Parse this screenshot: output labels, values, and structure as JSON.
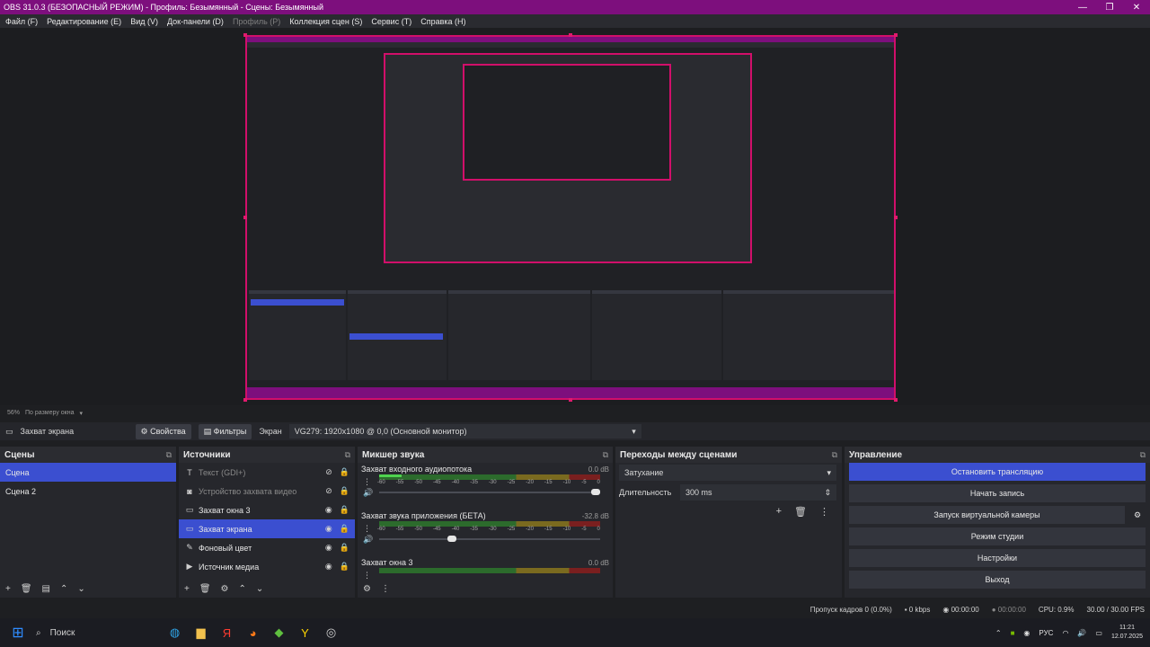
{
  "window": {
    "title": "OBS 31.0.3 (БЕЗОПАСНЫЙ РЕЖИМ) - Профиль: Безымянный - Сцены: Безымянный",
    "controls": [
      "—",
      "❐",
      "✕"
    ]
  },
  "menu": [
    {
      "label": "Файл (F)",
      "dim": false
    },
    {
      "label": "Редактирование (E)",
      "dim": false
    },
    {
      "label": "Вид (V)",
      "dim": false
    },
    {
      "label": "Док-панели (D)",
      "dim": false
    },
    {
      "label": "Профиль (P)",
      "dim": true
    },
    {
      "label": "Коллекция сцен (S)",
      "dim": false
    },
    {
      "label": "Сервис (T)",
      "dim": false
    },
    {
      "label": "Справка (H)",
      "dim": false
    }
  ],
  "preview": {
    "zoom": "56%",
    "scale_mode": "По размеру окна"
  },
  "source_toolbar": {
    "source_name": "Захват экрана",
    "properties": "Свойства",
    "filters": "Фильтры",
    "screen_label": "Экран",
    "screen_value": "VG279: 1920x1080 @ 0,0 (Основной монитор)"
  },
  "scenes": {
    "title": "Сцены",
    "items": [
      {
        "label": "Сцена",
        "selected": true
      },
      {
        "label": "Сцена 2",
        "selected": false
      }
    ]
  },
  "sources": {
    "title": "Источники",
    "items": [
      {
        "label": "Текст (GDI+)",
        "icon": "text-icon",
        "glyph": "T",
        "hidden": true,
        "selected": false
      },
      {
        "label": "Устройство захвата видео",
        "icon": "camera-icon",
        "glyph": "◙",
        "hidden": true,
        "selected": false
      },
      {
        "label": "Захват окна 3",
        "icon": "window-icon",
        "glyph": "▭",
        "hidden": false,
        "selected": false
      },
      {
        "label": "Захват экрана",
        "icon": "monitor-icon",
        "glyph": "▭",
        "hidden": false,
        "selected": true
      },
      {
        "label": "Фоновый цвет",
        "icon": "brush-icon",
        "glyph": "✎",
        "hidden": false,
        "selected": false
      },
      {
        "label": "Источник медиа",
        "icon": "play-icon",
        "glyph": "▶",
        "hidden": false,
        "selected": false
      }
    ]
  },
  "mixer": {
    "title": "Микшер звука",
    "scale": [
      "-60",
      "-55",
      "-50",
      "-45",
      "-40",
      "-35",
      "-30",
      "-25",
      "-20",
      "-15",
      "-10",
      "-5",
      "0"
    ],
    "channels": [
      {
        "name": "Захват входного аудиопотока",
        "db": "0.0 dB",
        "level": 0.1,
        "volume": 1.0
      },
      {
        "name": "Захват звука приложения (БЕТА)",
        "db": "-32.8 dB",
        "level": 0.0,
        "volume": 0.35
      },
      {
        "name": "Захват окна 3",
        "db": "0.0 dB",
        "level": 0.0,
        "volume": 1.0
      }
    ]
  },
  "transitions": {
    "title": "Переходы между сценами",
    "selected": "Затухание",
    "duration_label": "Длительность",
    "duration_value": "300 ms"
  },
  "controls": {
    "title": "Управление",
    "buttons": [
      {
        "label": "Остановить трансляцию",
        "primary": true
      },
      {
        "label": "Начать запись",
        "primary": false
      },
      {
        "label": "Запуск виртуальной камеры",
        "primary": false
      },
      {
        "label": "Режим студии",
        "primary": false
      },
      {
        "label": "Настройки",
        "primary": false
      },
      {
        "label": "Выход",
        "primary": false
      }
    ]
  },
  "status": {
    "dropped": "Пропуск кадров 0 (0.0%)",
    "bitrate": "0 kbps",
    "stream_time": "00:00:00",
    "rec_time": "00:00:00",
    "cpu": "CPU: 0.9%",
    "fps": "30.00 / 30.00 FPS"
  },
  "taskbar": {
    "search": "Поиск",
    "apps": [
      "edge-icon",
      "folder-icon",
      "yandex-icon",
      "firefox-icon",
      "utorrent-icon",
      "yandex-browser-icon",
      "obs-icon"
    ],
    "lang": "РУС",
    "time": "11:21",
    "date": "12.07.2025"
  }
}
